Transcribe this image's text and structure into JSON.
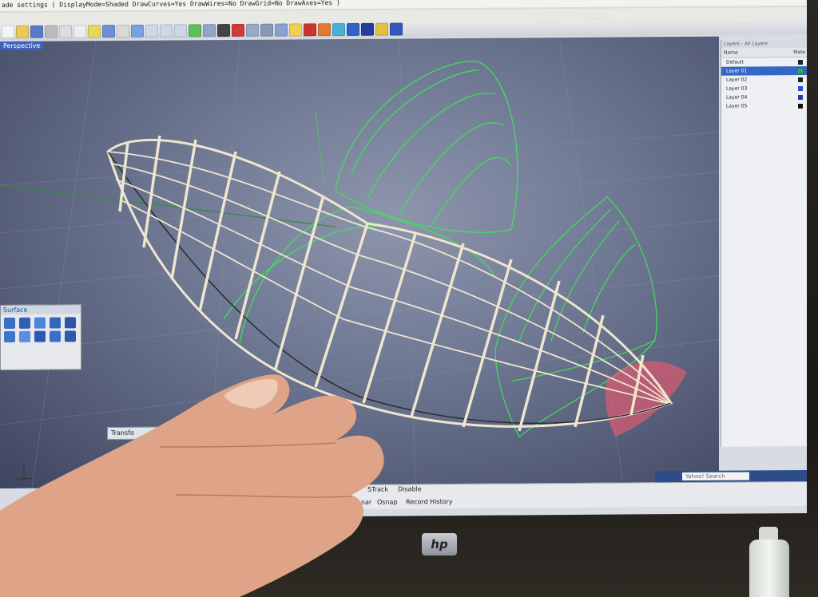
{
  "screen": {
    "command_line": "ade settings ( DisplayMode=Shaded  DrawCurves=Yes  DrawWires=No  DrawGrid=No  DrawAxes=Yes )",
    "viewport_title": "Perspective"
  },
  "layers_panel": {
    "title": "Layers - All Layers",
    "header_name": "Name",
    "header_material": "Mate",
    "layers": [
      {
        "name": "Default",
        "color": "#222222",
        "selected": false
      },
      {
        "name": "Layer 01",
        "color": "#22b24c",
        "selected": true
      },
      {
        "name": "Layer 02",
        "color": "#222222",
        "selected": false
      },
      {
        "name": "Layer 03",
        "color": "#2a4fd0",
        "selected": false
      },
      {
        "name": "Layer 04",
        "color": "#1e3aa8",
        "selected": false
      },
      {
        "name": "Layer 05",
        "color": "#111111",
        "selected": false
      }
    ]
  },
  "surface_panel": {
    "title": "Surface"
  },
  "transform_tab": {
    "label": "Transfo"
  },
  "statusbar": {
    "stack": "STrack",
    "disable": "Disable",
    "planar": "Planar",
    "osnap": "Osnap",
    "record_history": "Record History"
  },
  "taskbar": {
    "search_placeholder": "Yahoo! Search"
  },
  "monitor": {
    "logo": "hp"
  },
  "colors": {
    "wireframe_green": "#3fe05a",
    "balsa": "#efe6cf",
    "viewport": "#6f7893",
    "skin": "#e2a58b"
  }
}
